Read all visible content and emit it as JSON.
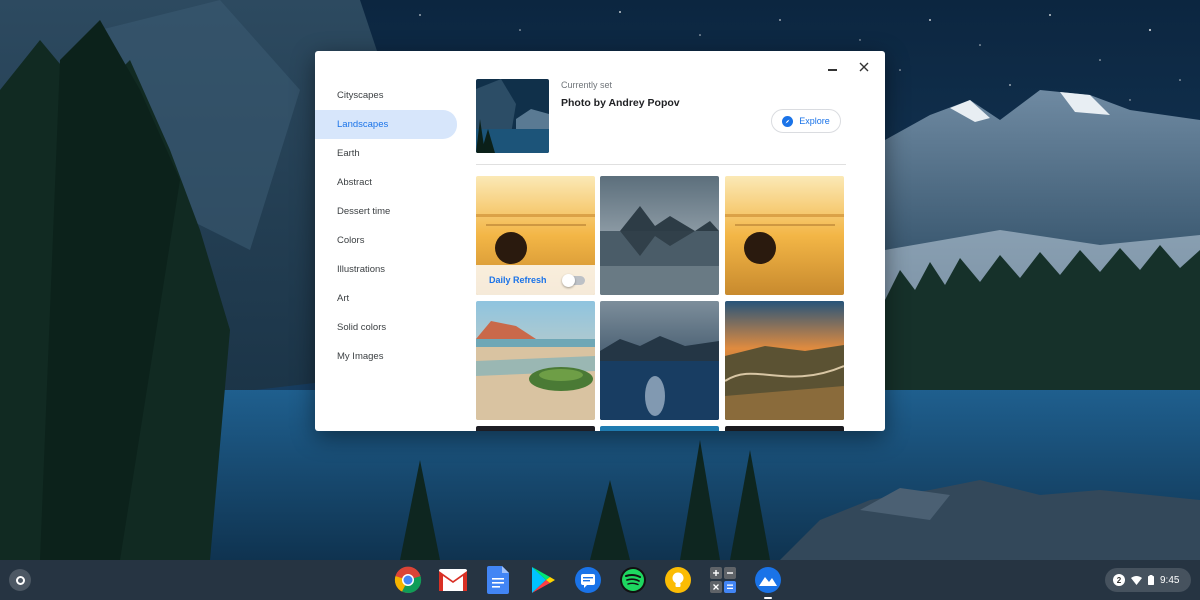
{
  "window": {
    "minimize_label": "Minimize",
    "close_label": "Close"
  },
  "sidebar": {
    "items": [
      {
        "label": "Cityscapes",
        "active": false
      },
      {
        "label": "Landscapes",
        "active": true
      },
      {
        "label": "Earth",
        "active": false
      },
      {
        "label": "Abstract",
        "active": false
      },
      {
        "label": "Dessert time",
        "active": false
      },
      {
        "label": "Colors",
        "active": false
      },
      {
        "label": "Illustrations",
        "active": false
      },
      {
        "label": "Art",
        "active": false
      },
      {
        "label": "Solid colors",
        "active": false
      },
      {
        "label": "My Images",
        "active": false
      }
    ]
  },
  "current": {
    "label": "Currently set",
    "title": "Photo by Andrey Popov",
    "explore_label": "Explore"
  },
  "daily_refresh": {
    "label": "Daily Refresh",
    "enabled": false
  },
  "shelf": {
    "apps": [
      "chrome-icon",
      "gmail-icon",
      "docs-icon",
      "play-store-icon",
      "messages-icon",
      "spotify-icon",
      "keep-icon",
      "calculator-icon",
      "wallpaper-app-icon"
    ],
    "notification_count": "2",
    "time": "9:45"
  },
  "colors": {
    "accent": "#1a73e8",
    "active_bg": "#d7e6fb"
  }
}
